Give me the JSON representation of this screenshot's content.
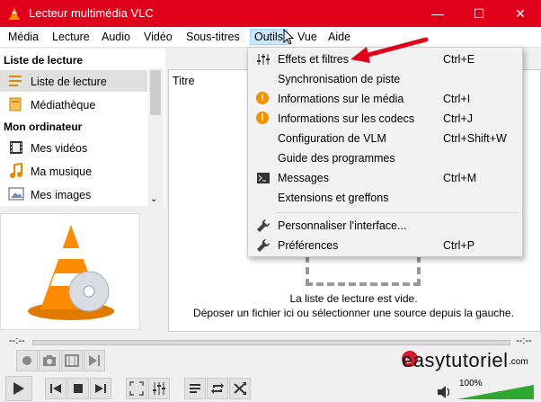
{
  "window": {
    "title": "Lecteur multimédia VLC",
    "controls": [
      "—",
      "☐",
      "✕"
    ]
  },
  "menubar": {
    "items": [
      "Média",
      "Lecture",
      "Audio",
      "Vidéo",
      "Sous-titres",
      "Outils",
      "Vue",
      "Aide"
    ],
    "active": "Outils"
  },
  "sidebar": {
    "playlist_section": "Liste de lecture",
    "playlist_items": [
      "Liste de lecture",
      "Médiathèque"
    ],
    "computer_section": "Mon ordinateur",
    "computer_items": [
      "Mes vidéos",
      "Ma musique",
      "Mes images"
    ]
  },
  "playlist": {
    "column_title": "Titre",
    "empty_line1": "La liste de lecture est vide.",
    "empty_line2": "Déposer un fichier ici ou sélectionner une source depuis la gauche."
  },
  "tools_menu": {
    "items": [
      {
        "label": "Effets et filtres",
        "shortcut": "Ctrl+E",
        "icon": "equalizer-icon"
      },
      {
        "label": "Synchronisation de piste",
        "shortcut": "",
        "icon": ""
      },
      {
        "label": "Informations sur le média",
        "shortcut": "Ctrl+I",
        "icon": "info-icon"
      },
      {
        "label": "Informations sur les codecs",
        "shortcut": "Ctrl+J",
        "icon": "info-icon"
      },
      {
        "label": "Configuration de VLM",
        "shortcut": "Ctrl+Shift+W",
        "icon": ""
      },
      {
        "label": "Guide des programmes",
        "shortcut": "",
        "icon": ""
      },
      {
        "label": "Messages",
        "shortcut": "Ctrl+M",
        "icon": "terminal-icon"
      },
      {
        "label": "Extensions et greffons",
        "shortcut": "",
        "icon": ""
      },
      {
        "label": "Personnaliser l'interface...",
        "shortcut": "",
        "icon": "wrench-icon"
      },
      {
        "label": "Préférences",
        "shortcut": "Ctrl+P",
        "icon": "wrench-icon"
      }
    ]
  },
  "player": {
    "time_elapsed": "--:--",
    "time_total": "--:--",
    "volume": "100%",
    "volume_level": 1.0
  },
  "watermark": {
    "brand": "easytutoriel",
    "suffix": ".com"
  },
  "colors": {
    "titlebar": "#e0001c",
    "accent": "#f29000",
    "menu_highlight": "#cce8ff",
    "volume_green": "#2ea82e"
  }
}
